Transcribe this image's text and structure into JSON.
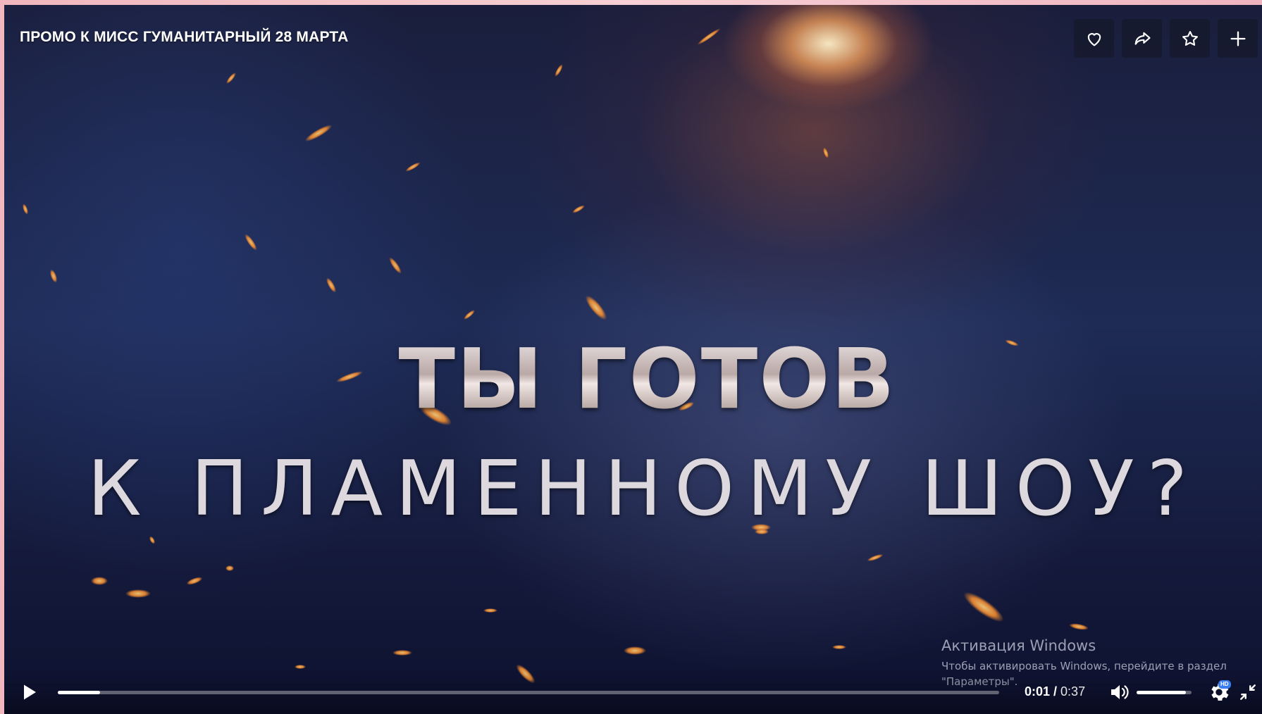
{
  "video": {
    "title": "ПРОМО К МИСС ГУМАНИТАРНЫЙ 28 МАРТА",
    "line1": "ТЫ ГОТОВ",
    "line2": "К ПЛАМЕННОМУ ШОУ?"
  },
  "actions": [
    {
      "name": "like",
      "icon": "heart-icon"
    },
    {
      "name": "share",
      "icon": "share-icon"
    },
    {
      "name": "favorite",
      "icon": "star-icon"
    },
    {
      "name": "add",
      "icon": "plus-icon"
    }
  ],
  "controls": {
    "current_time": "0:01",
    "separator": " / ",
    "duration": "0:37",
    "progress": 0.045,
    "volume": 0.9,
    "hd_badge": "HD"
  },
  "watermark": {
    "title": "Активация Windows",
    "subtitle": "Чтобы активировать Windows, перейдите в раздел \"Параметры\"."
  },
  "colors": {
    "accent": "#3b7df0",
    "background": "#1e2b55"
  }
}
